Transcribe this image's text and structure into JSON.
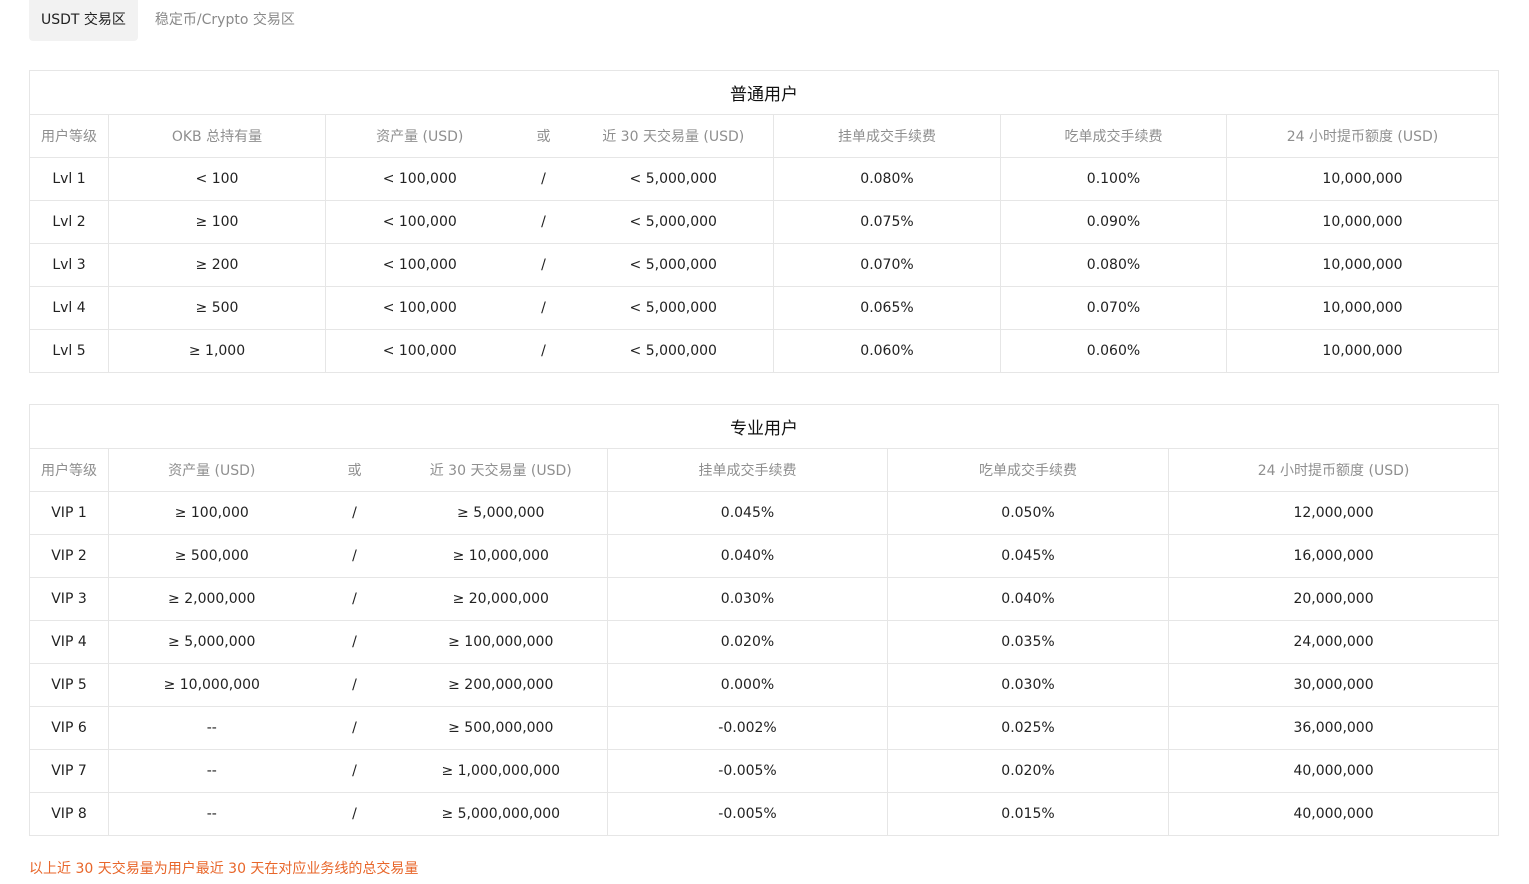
{
  "tabs": [
    {
      "label": "USDT 交易区",
      "active": true
    },
    {
      "label": "稳定币/Crypto 交易区",
      "active": false
    }
  ],
  "regular": {
    "title": "普通用户",
    "headers": [
      "用户等级",
      "OKB 总持有量",
      "资产量 (USD)",
      "或",
      "近 30 天交易量 (USD)",
      "挂单成交手续费",
      "吃单成交手续费",
      "24 小时提币额度 (USD)"
    ],
    "rows": [
      [
        "Lvl 1",
        "< 100",
        "< 100,000",
        "/",
        "< 5,000,000",
        "0.080%",
        "0.100%",
        "10,000,000"
      ],
      [
        "Lvl 2",
        "≥ 100",
        "< 100,000",
        "/",
        "< 5,000,000",
        "0.075%",
        "0.090%",
        "10,000,000"
      ],
      [
        "Lvl 3",
        "≥ 200",
        "< 100,000",
        "/",
        "< 5,000,000",
        "0.070%",
        "0.080%",
        "10,000,000"
      ],
      [
        "Lvl 4",
        "≥ 500",
        "< 100,000",
        "/",
        "< 5,000,000",
        "0.065%",
        "0.070%",
        "10,000,000"
      ],
      [
        "Lvl 5",
        "≥ 1,000",
        "< 100,000",
        "/",
        "< 5,000,000",
        "0.060%",
        "0.060%",
        "10,000,000"
      ]
    ]
  },
  "pro": {
    "title": "专业用户",
    "headers": [
      "用户等级",
      "资产量 (USD)",
      "或",
      "近 30 天交易量 (USD)",
      "挂单成交手续费",
      "吃单成交手续费",
      "24 小时提币额度 (USD)"
    ],
    "rows": [
      [
        "VIP 1",
        "≥ 100,000",
        "/",
        "≥ 5,000,000",
        "0.045%",
        "0.050%",
        "12,000,000"
      ],
      [
        "VIP 2",
        "≥ 500,000",
        "/",
        "≥ 10,000,000",
        "0.040%",
        "0.045%",
        "16,000,000"
      ],
      [
        "VIP 3",
        "≥ 2,000,000",
        "/",
        "≥ 20,000,000",
        "0.030%",
        "0.040%",
        "20,000,000"
      ],
      [
        "VIP 4",
        "≥ 5,000,000",
        "/",
        "≥ 100,000,000",
        "0.020%",
        "0.035%",
        "24,000,000"
      ],
      [
        "VIP 5",
        "≥ 10,000,000",
        "/",
        "≥ 200,000,000",
        "0.000%",
        "0.030%",
        "30,000,000"
      ],
      [
        "VIP 6",
        "--",
        "/",
        "≥ 500,000,000",
        "-0.002%",
        "0.025%",
        "36,000,000"
      ],
      [
        "VIP 7",
        "--",
        "/",
        "≥ 1,000,000,000",
        "-0.005%",
        "0.020%",
        "40,000,000"
      ],
      [
        "VIP 8",
        "--",
        "/",
        "≥ 5,000,000,000",
        "-0.005%",
        "0.015%",
        "40,000,000"
      ]
    ]
  },
  "footnote": "以上近 30 天交易量为用户最近 30 天在对应业务线的总交易量",
  "colors": {
    "footnote": "#e8662a",
    "active_tab_bg": "#f2f2f2",
    "border": "#e6e6e6"
  }
}
